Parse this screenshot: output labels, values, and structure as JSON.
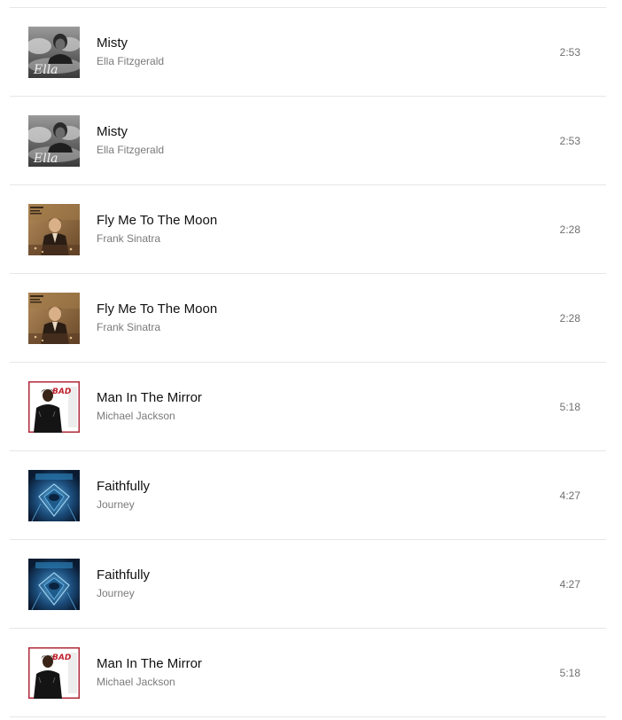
{
  "tracks": [
    {
      "title": "Misty",
      "artist": "Ella Fitzgerald",
      "duration": "2:53",
      "art": "ella-album-art"
    },
    {
      "title": "Misty",
      "artist": "Ella Fitzgerald",
      "duration": "2:53",
      "art": "ella-album-art"
    },
    {
      "title": "Fly Me To The Moon",
      "artist": "Frank Sinatra",
      "duration": "2:28",
      "art": "sinatra-album-art"
    },
    {
      "title": "Fly Me To The Moon",
      "artist": "Frank Sinatra",
      "duration": "2:28",
      "art": "sinatra-album-art"
    },
    {
      "title": "Man In The Mirror",
      "artist": "Michael Jackson",
      "duration": "5:18",
      "art": "bad-album-art"
    },
    {
      "title": "Faithfully",
      "artist": "Journey",
      "duration": "4:27",
      "art": "frontiers-album-art"
    },
    {
      "title": "Faithfully",
      "artist": "Journey",
      "duration": "4:27",
      "art": "frontiers-album-art"
    },
    {
      "title": "Man In The Mirror",
      "artist": "Michael Jackson",
      "duration": "5:18",
      "art": "bad-album-art"
    }
  ],
  "colors": {
    "title": "#111111",
    "artist": "#7a7a7a",
    "duration": "#6f6f6f",
    "divider": "#e6e6e6"
  }
}
